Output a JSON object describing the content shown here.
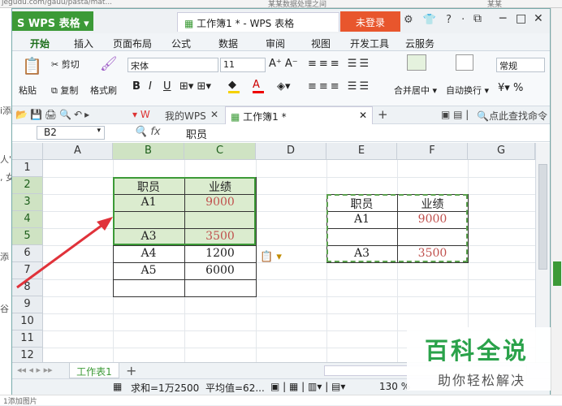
{
  "browser": {
    "url_fragment": "jegudu.com/gauu/pasta/mat...",
    "center_text": "某某数据处理之间",
    "right_text": "某某"
  },
  "bg_page": {
    "line1": "i添",
    "line2": "人\"",
    "line3": ", 女",
    "line4": "添",
    "line5": "谷"
  },
  "bottom_strip": {
    "text": "1添加图片"
  },
  "window": {
    "app_label": "WPS 表格",
    "doc_tab": "工作簿1 * - WPS 表格",
    "login_label": "未登录",
    "title_icons": "⚙ 👕 ? ·",
    "min": "─",
    "max": "□",
    "close": "✕"
  },
  "menu": {
    "items": [
      "开始",
      "插入",
      "页面布局",
      "公式",
      "数据",
      "审阅",
      "视图",
      "开发工具",
      "云服务"
    ]
  },
  "ribbon": {
    "paste": "粘贴",
    "cut": "剪切",
    "copy": "复制",
    "format_painter": "格式刷",
    "font": "宋体",
    "size": "11",
    "bold": "B",
    "italic": "I",
    "underline": "U",
    "merge": "合并居中",
    "wrap": "自动换行",
    "number_format": "常规",
    "percent": "%"
  },
  "quick_access": {
    "mywps": "我的WPS",
    "file_tab": "工作簿1 *",
    "search": "点此查找命令"
  },
  "formula_bar": {
    "cell_ref": "B2",
    "fx": "fx",
    "value": "职员"
  },
  "columns": [
    "A",
    "B",
    "C",
    "D",
    "E",
    "F",
    "G"
  ],
  "rows": [
    "1",
    "2",
    "3",
    "4",
    "5",
    "6",
    "7",
    "8",
    "9",
    "10",
    "11",
    "12"
  ],
  "table1": {
    "header": [
      "职员",
      "业绩"
    ],
    "rows": [
      [
        "A1",
        "9000"
      ],
      [
        "",
        ""
      ],
      [
        "A3",
        "3500"
      ],
      [
        "A4",
        "1200"
      ],
      [
        "A5",
        "6000"
      ]
    ]
  },
  "table2": {
    "header": [
      "职员",
      "业绩"
    ],
    "rows": [
      [
        "A1",
        "9000"
      ],
      [
        "",
        ""
      ],
      [
        "A3",
        "3500"
      ]
    ]
  },
  "sheet": {
    "tab": "工作表1",
    "add": "+"
  },
  "status": {
    "sum": "求和=1万2500",
    "avg": "平均值=62...",
    "zoom": "130 %"
  },
  "watermark": {
    "title": "百科全说",
    "subtitle": "助你轻松解决"
  },
  "colors": {
    "accent": "#3c9a37",
    "login": "#e8562d",
    "value_red": "#c0504d"
  }
}
